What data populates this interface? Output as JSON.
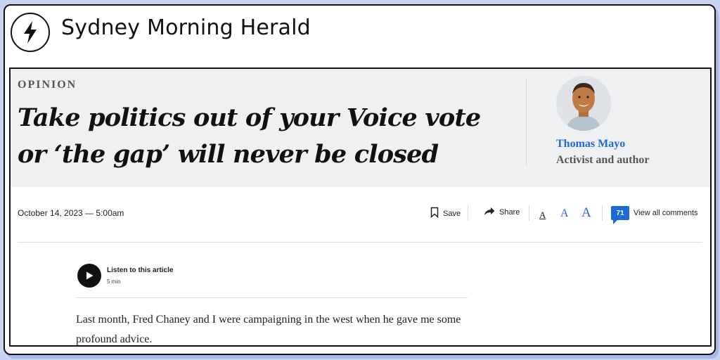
{
  "site": {
    "title": "Sydney Morning Herald",
    "icon": "lightning-bolt-icon"
  },
  "article": {
    "section": "OPINION",
    "headline": "Take politics out of your Voice vote or ‘the gap’ will never be closed",
    "author": {
      "name": "Thomas Mayo",
      "role": "Activist and author"
    },
    "date": "October 14, 2023 — 5:00am",
    "body": "Last month, Fred Chaney and I were campaigning in the west when he gave me some profound advice."
  },
  "toolbar": {
    "save_label": "Save",
    "share_label": "Share",
    "font_sizes": [
      "A",
      "A",
      "A"
    ],
    "comment_count": "71",
    "comments_label": "View all comments"
  },
  "audio": {
    "title": "Listen to this article",
    "duration": "5 min"
  },
  "colors": {
    "accent": "#1d6ad6",
    "header_bg": "#eef0f2",
    "page_bg": "#c9d4f2"
  }
}
